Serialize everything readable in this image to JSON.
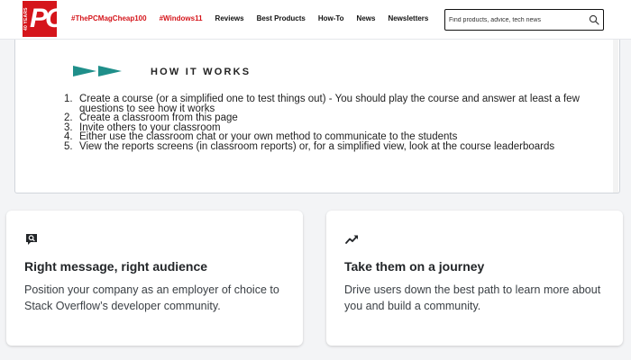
{
  "brand": {
    "logo_text": "PC",
    "logo_years": "40 YEARS",
    "brand_color": "#d5151b"
  },
  "nav": {
    "links": [
      {
        "label": "#ThePCMagCheap100",
        "highlight": true
      },
      {
        "label": "#Windows11",
        "highlight": true
      },
      {
        "label": "Reviews",
        "highlight": false
      },
      {
        "label": "Best Products",
        "highlight": false
      },
      {
        "label": "How-To",
        "highlight": false
      },
      {
        "label": "News",
        "highlight": false
      },
      {
        "label": "Newsletters",
        "highlight": false
      }
    ]
  },
  "search": {
    "placeholder": "Find products, advice, tech news",
    "icon": "search-icon"
  },
  "how_it_works": {
    "title": "HOW IT WORKS",
    "steps": [
      {
        "num": "1.",
        "text": "Create a course (or a simplified one to test things out) - You should play the course and answer at least a few questions to see how it works"
      },
      {
        "num": "2.",
        "text": "Create a classroom from this page"
      },
      {
        "num": "3.",
        "text": "Invite others to your classroom"
      },
      {
        "num": "4.",
        "text": "Either use the classroom chat or your own method to communicate to the students"
      },
      {
        "num": "5.",
        "text": "View the reports screens (in classroom reports) or, for a simplified view, look at the course leaderboards"
      }
    ]
  },
  "cards": [
    {
      "icon": "message-search-icon",
      "title": "Right message, right audience",
      "text": "Position your company as an employer of choice to Stack Overflow’s developer community."
    },
    {
      "icon": "trending-up-icon",
      "title": "Take them on a journey",
      "text": "Drive users down the best path to learn more about you and build a community."
    }
  ]
}
